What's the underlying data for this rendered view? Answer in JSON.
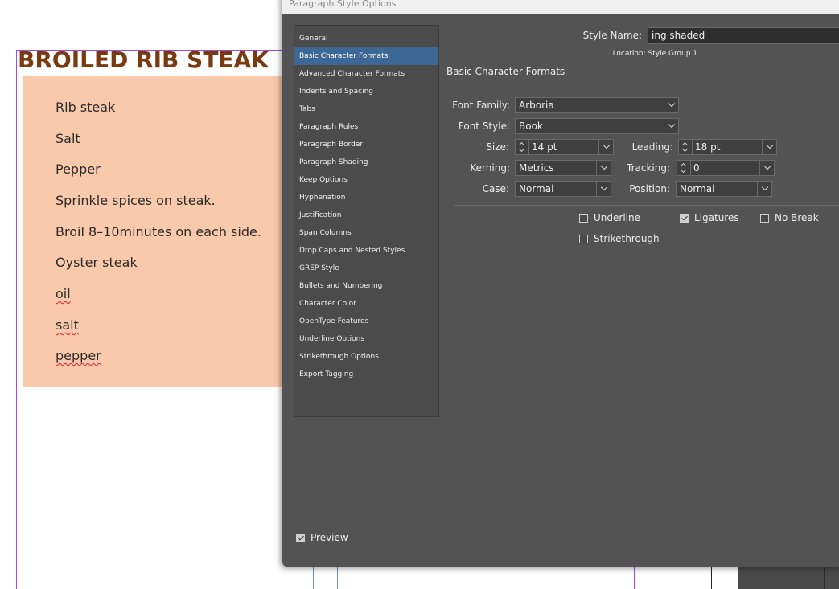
{
  "document": {
    "title": "BROILED RIB STEAK",
    "ingredients": [
      {
        "text": "Rib steak",
        "spell_error": false
      },
      {
        "text": "Salt",
        "spell_error": false
      },
      {
        "text": "Pepper",
        "spell_error": false
      },
      {
        "text": "Sprinkle spices on steak.",
        "spell_error": false
      },
      {
        "text": "Broil 8–10minutes on each side.",
        "spell_error": false
      },
      {
        "text": "Oyster steak",
        "spell_error": false
      },
      {
        "text": "oil",
        "spell_error": true
      },
      {
        "text": "salt",
        "spell_error": true
      },
      {
        "text": "pepper",
        "spell_error": true
      }
    ],
    "colors": {
      "title": "#7a3a10",
      "shading": "#f9c9ab",
      "guide": "#a24bd6"
    }
  },
  "dialog": {
    "title": "Paragraph Style Options",
    "nav": [
      {
        "label": "General",
        "selected": false
      },
      {
        "label": "Basic Character Formats",
        "selected": true
      },
      {
        "label": "Advanced Character Formats",
        "selected": false
      },
      {
        "label": "Indents and Spacing",
        "selected": false
      },
      {
        "label": "Tabs",
        "selected": false
      },
      {
        "label": "Paragraph Rules",
        "selected": false
      },
      {
        "label": "Paragraph Border",
        "selected": false
      },
      {
        "label": "Paragraph Shading",
        "selected": false
      },
      {
        "label": "Keep Options",
        "selected": false
      },
      {
        "label": "Hyphenation",
        "selected": false
      },
      {
        "label": "Justification",
        "selected": false
      },
      {
        "label": "Span Columns",
        "selected": false
      },
      {
        "label": "Drop Caps and Nested Styles",
        "selected": false
      },
      {
        "label": "GREP Style",
        "selected": false
      },
      {
        "label": "Bullets and Numbering",
        "selected": false
      },
      {
        "label": "Character Color",
        "selected": false
      },
      {
        "label": "OpenType Features",
        "selected": false
      },
      {
        "label": "Underline Options",
        "selected": false
      },
      {
        "label": "Strikethrough Options",
        "selected": false
      },
      {
        "label": "Export Tagging",
        "selected": false
      }
    ],
    "style_name_label": "Style Name:",
    "style_name_value": "ing shaded",
    "location_label": "Location:",
    "location_value": "Style Group 1",
    "section_title": "Basic Character Formats",
    "font_family_label": "Font Family:",
    "font_family_value": "Arboria",
    "font_style_label": "Font Style:",
    "font_style_value": "Book",
    "size_label": "Size:",
    "size_value": "14 pt",
    "leading_label": "Leading:",
    "leading_value": "18 pt",
    "kerning_label": "Kerning:",
    "kerning_value": "Metrics",
    "tracking_label": "Tracking:",
    "tracking_value": "0",
    "case_label": "Case:",
    "case_value": "Normal",
    "position_label": "Position:",
    "position_value": "Normal",
    "underline_label": "Underline",
    "underline_checked": false,
    "ligatures_label": "Ligatures",
    "ligatures_checked": true,
    "nobreak_label": "No Break",
    "nobreak_checked": false,
    "strikethrough_label": "Strikethrough",
    "strikethrough_checked": false,
    "preview_label": "Preview",
    "preview_checked": true
  }
}
